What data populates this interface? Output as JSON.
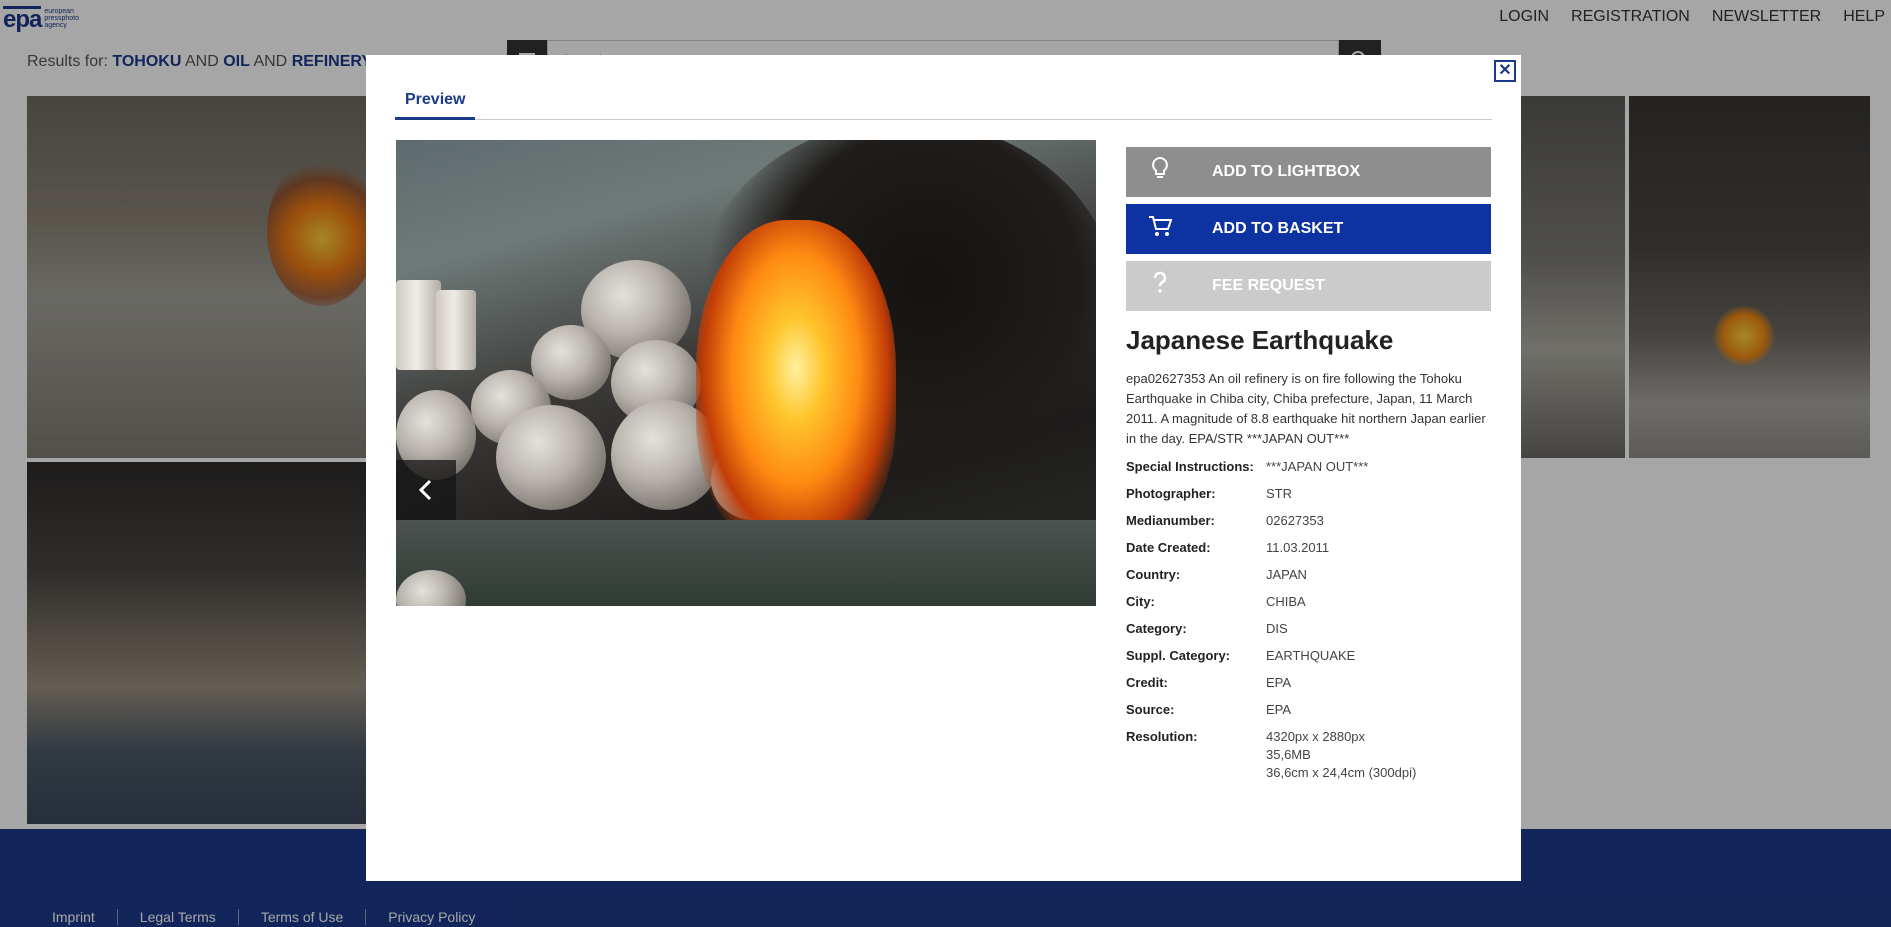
{
  "logo": {
    "mark": "epa",
    "sub": "european pressphoto agency"
  },
  "topnav": {
    "login": "LOGIN",
    "registration": "REGISTRATION",
    "newsletter": "NEWSLETTER",
    "help": "HELP"
  },
  "results": {
    "prefix": "Results for:",
    "term1": "TOHOKU",
    "and1": "AND",
    "term2": "OIL",
    "and2": "AND",
    "term3": "REFINERY"
  },
  "search": {
    "placeholder": "Search..."
  },
  "footer": {
    "links": [
      "Imprint",
      "Legal Terms",
      "Terms of Use",
      "Privacy Policy"
    ]
  },
  "modal": {
    "tab_label": "Preview",
    "close_glyph": "✕",
    "actions": {
      "lightbox": "ADD TO LIGHTBOX",
      "basket": "ADD TO BASKET",
      "fee": "FEE REQUEST"
    },
    "title": "Japanese Earthquake",
    "caption": "epa02627353 An oil refinery is on fire following the Tohoku Earthquake in Chiba city, Chiba prefecture, Japan, 11 March 2011. A magnitude of 8.8 earthquake hit northern Japan earlier in the day. EPA/STR ***JAPAN OUT***",
    "meta": [
      {
        "key": "Special Instructions:",
        "val": "***JAPAN OUT***"
      },
      {
        "key": "Photographer:",
        "val": "STR"
      },
      {
        "key": "Medianumber:",
        "val": "02627353"
      },
      {
        "key": "Date Created:",
        "val": "11.03.2011"
      },
      {
        "key": "Country:",
        "val": "JAPAN"
      },
      {
        "key": "City:",
        "val": "CHIBA"
      },
      {
        "key": "Category:",
        "val": "DIS"
      },
      {
        "key": "Suppl. Category:",
        "val": "EARTHQUAKE"
      },
      {
        "key": "Credit:",
        "val": "EPA"
      },
      {
        "key": "Source:",
        "val": "EPA"
      }
    ],
    "resolution": {
      "key": "Resolution:",
      "line1": "4320px x 2880px",
      "line2": "35,6MB",
      "line3": "36,6cm x 24,4cm (300dpi)"
    }
  },
  "colors": {
    "brand": "#1b3a8a",
    "basket": "#0d32a1",
    "lightbox": "#8e8e8e",
    "fee": "#cbcbcb"
  },
  "icons": {
    "lightbox": "lightbulb-icon",
    "basket": "cart-icon",
    "fee": "question-icon",
    "prev": "chevron-left-icon",
    "close": "close-icon",
    "search": "search-icon",
    "list": "list-icon"
  }
}
